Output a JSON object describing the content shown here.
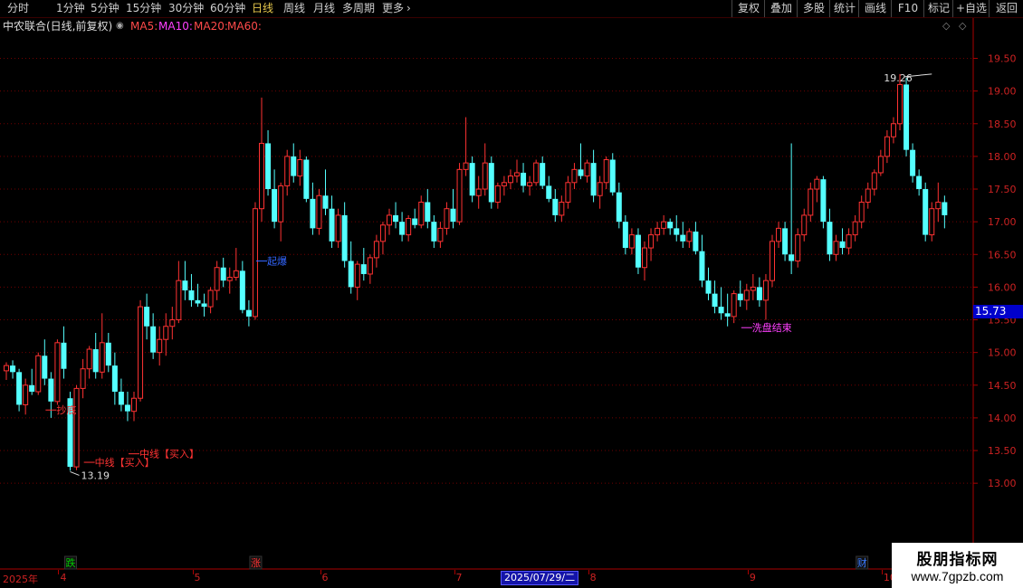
{
  "toolbar": {
    "periods": [
      "分时",
      "1分钟",
      "5分钟",
      "15分钟",
      "30分钟",
      "60分钟",
      "日线",
      "周线",
      "月线",
      "多周期",
      "更多"
    ],
    "active_period": "日线",
    "buttons": [
      "复权",
      "叠加",
      "多股",
      "统计",
      "画线",
      "F10",
      "标记",
      "+自选",
      "返回"
    ]
  },
  "header": {
    "stock": "中农联合(日线,前复权)",
    "ma_labels": [
      {
        "text": "MA5:",
        "color": "#ff4a4a"
      },
      {
        "text": "MA10:",
        "color": "#ff40ff"
      },
      {
        "text": "MA20:",
        "color": "#ff4a4a"
      },
      {
        "text": "MA60:",
        "color": "#ff4a4a"
      }
    ]
  },
  "chart_data": {
    "type": "candlestick",
    "yaxis_ticks": [
      13.0,
      13.5,
      14.0,
      14.5,
      15.0,
      15.5,
      16.0,
      16.5,
      17.0,
      17.5,
      18.0,
      18.5,
      19.0,
      19.5
    ],
    "ylim": [
      12.85,
      19.95
    ],
    "current_price_label": "15.73",
    "current_price": 15.73,
    "colors": {
      "up": "#ff3232",
      "down": "#54ffff",
      "axis": "#aa0000",
      "grid": "#700000"
    },
    "annotations": [
      {
        "text": "19.26",
        "type": "high",
        "index": 145,
        "price": 19.26,
        "color": "#dddddd"
      },
      {
        "text": "13.19",
        "type": "low",
        "index": 10,
        "price": 13.19,
        "color": "#dddddd"
      },
      {
        "text": "抄底",
        "index": 7,
        "price": 14.12,
        "color": "#ff3333"
      },
      {
        "text": "中线【买入】",
        "index": 13,
        "price": 13.32,
        "color": "#ff3333"
      },
      {
        "text": "中线【买入】",
        "index": 20,
        "price": 13.45,
        "color": "#ff3333"
      },
      {
        "text": "起爆",
        "index": 40,
        "price": 16.4,
        "color": "#3366ff"
      },
      {
        "text": "洗盘结束",
        "index": 116,
        "price": 15.38,
        "color": "#ff40ff"
      }
    ],
    "markers": [
      {
        "text": "跌",
        "index": 10,
        "color": "#00cc00"
      },
      {
        "text": "涨",
        "index": 39,
        "color": "#ff3333"
      },
      {
        "text": "财",
        "index": 134,
        "color": "#3a7bff"
      }
    ],
    "candles": [
      [
        14.72,
        14.85,
        14.58,
        14.8
      ],
      [
        14.8,
        14.88,
        14.6,
        14.7
      ],
      [
        14.7,
        14.75,
        14.1,
        14.2
      ],
      [
        14.2,
        14.6,
        14.05,
        14.5
      ],
      [
        14.5,
        14.75,
        14.35,
        14.4
      ],
      [
        14.4,
        15.0,
        14.35,
        14.95
      ],
      [
        14.95,
        15.2,
        14.5,
        14.6
      ],
      [
        14.6,
        14.7,
        14.0,
        14.25
      ],
      [
        14.25,
        15.2,
        14.2,
        15.15
      ],
      [
        15.15,
        15.4,
        14.6,
        14.75
      ],
      [
        14.3,
        14.4,
        13.19,
        13.25
      ],
      [
        13.25,
        14.5,
        13.2,
        14.45
      ],
      [
        14.45,
        14.9,
        14.3,
        14.75
      ],
      [
        14.75,
        15.1,
        14.6,
        15.05
      ],
      [
        15.05,
        15.3,
        14.6,
        14.7
      ],
      [
        14.7,
        15.6,
        14.6,
        15.15
      ],
      [
        15.15,
        15.3,
        14.7,
        14.8
      ],
      [
        14.8,
        15.0,
        14.2,
        14.4
      ],
      [
        14.4,
        14.6,
        14.1,
        14.2
      ],
      [
        14.2,
        14.4,
        13.95,
        14.1
      ],
      [
        14.1,
        14.4,
        13.95,
        14.3
      ],
      [
        14.3,
        15.8,
        14.25,
        15.7
      ],
      [
        15.7,
        15.9,
        15.2,
        15.4
      ],
      [
        15.4,
        15.6,
        14.9,
        15.0
      ],
      [
        15.0,
        15.4,
        14.8,
        15.2
      ],
      [
        15.2,
        15.6,
        14.95,
        15.4
      ],
      [
        15.4,
        15.7,
        15.2,
        15.5
      ],
      [
        15.5,
        16.4,
        15.45,
        16.1
      ],
      [
        16.1,
        16.4,
        15.8,
        15.95
      ],
      [
        15.95,
        16.2,
        15.7,
        15.8
      ],
      [
        15.8,
        16.05,
        15.7,
        15.75
      ],
      [
        15.75,
        15.9,
        15.55,
        15.7
      ],
      [
        15.7,
        16.0,
        15.6,
        15.95
      ],
      [
        15.95,
        16.4,
        15.8,
        16.3
      ],
      [
        16.3,
        16.45,
        16.0,
        16.1
      ],
      [
        16.1,
        16.3,
        15.9,
        16.15
      ],
      [
        16.15,
        16.6,
        16.1,
        16.25
      ],
      [
        16.25,
        16.4,
        15.6,
        15.65
      ],
      [
        15.65,
        15.8,
        15.4,
        15.55
      ],
      [
        15.55,
        17.3,
        15.5,
        17.2
      ],
      [
        17.2,
        18.9,
        17.0,
        18.2
      ],
      [
        18.2,
        18.4,
        17.4,
        17.5
      ],
      [
        17.5,
        17.8,
        16.9,
        17.0
      ],
      [
        17.0,
        17.6,
        16.7,
        17.55
      ],
      [
        17.55,
        18.1,
        17.4,
        18.0
      ],
      [
        18.0,
        18.2,
        17.6,
        17.7
      ],
      [
        17.7,
        18.1,
        17.55,
        17.95
      ],
      [
        17.95,
        18.0,
        17.3,
        17.35
      ],
      [
        17.35,
        17.6,
        16.8,
        16.9
      ],
      [
        16.9,
        17.5,
        16.8,
        17.4
      ],
      [
        17.4,
        17.8,
        17.1,
        17.2
      ],
      [
        17.2,
        17.4,
        16.6,
        16.7
      ],
      [
        16.7,
        17.2,
        16.6,
        17.1
      ],
      [
        17.1,
        17.3,
        16.3,
        16.4
      ],
      [
        16.4,
        16.7,
        15.9,
        16.0
      ],
      [
        16.0,
        16.4,
        15.8,
        16.35
      ],
      [
        16.35,
        16.6,
        16.1,
        16.2
      ],
      [
        16.2,
        16.5,
        16.05,
        16.45
      ],
      [
        16.45,
        16.8,
        16.3,
        16.7
      ],
      [
        16.7,
        17.0,
        16.5,
        16.95
      ],
      [
        16.95,
        17.2,
        16.8,
        17.1
      ],
      [
        17.1,
        17.3,
        16.9,
        17.0
      ],
      [
        17.0,
        17.15,
        16.7,
        16.8
      ],
      [
        16.8,
        17.1,
        16.7,
        17.05
      ],
      [
        17.05,
        17.2,
        16.9,
        16.95
      ],
      [
        16.95,
        17.4,
        16.9,
        17.3
      ],
      [
        17.3,
        17.5,
        16.9,
        17.0
      ],
      [
        17.0,
        17.1,
        16.6,
        16.7
      ],
      [
        16.7,
        17.0,
        16.6,
        16.9
      ],
      [
        16.9,
        17.3,
        16.8,
        17.2
      ],
      [
        17.2,
        17.5,
        16.9,
        17.0
      ],
      [
        17.0,
        17.9,
        16.95,
        17.8
      ],
      [
        17.8,
        18.6,
        17.7,
        17.9
      ],
      [
        17.9,
        18.0,
        17.3,
        17.4
      ],
      [
        17.4,
        17.7,
        17.2,
        17.5
      ],
      [
        17.5,
        18.2,
        17.4,
        17.9
      ],
      [
        17.9,
        18.0,
        17.2,
        17.3
      ],
      [
        17.3,
        17.6,
        17.2,
        17.55
      ],
      [
        17.55,
        17.7,
        17.4,
        17.6
      ],
      [
        17.6,
        17.8,
        17.5,
        17.7
      ],
      [
        17.7,
        17.95,
        17.6,
        17.75
      ],
      [
        17.75,
        17.9,
        17.45,
        17.55
      ],
      [
        17.55,
        17.7,
        17.4,
        17.6
      ],
      [
        17.6,
        17.95,
        17.55,
        17.9
      ],
      [
        17.9,
        18.0,
        17.5,
        17.55
      ],
      [
        17.55,
        17.7,
        17.3,
        17.35
      ],
      [
        17.35,
        17.5,
        17.0,
        17.1
      ],
      [
        17.1,
        17.4,
        17.0,
        17.3
      ],
      [
        17.3,
        17.7,
        17.2,
        17.6
      ],
      [
        17.6,
        17.9,
        17.5,
        17.8
      ],
      [
        17.8,
        18.2,
        17.65,
        17.7
      ],
      [
        17.7,
        17.95,
        17.6,
        17.9
      ],
      [
        17.9,
        18.1,
        17.3,
        17.4
      ],
      [
        17.4,
        17.7,
        17.2,
        17.6
      ],
      [
        17.6,
        18.0,
        17.5,
        17.95
      ],
      [
        17.95,
        18.05,
        17.4,
        17.45
      ],
      [
        17.45,
        17.6,
        16.9,
        17.0
      ],
      [
        17.0,
        17.1,
        16.5,
        16.6
      ],
      [
        16.6,
        16.9,
        16.5,
        16.8
      ],
      [
        16.8,
        16.9,
        16.2,
        16.3
      ],
      [
        16.3,
        16.7,
        16.1,
        16.6
      ],
      [
        16.6,
        16.9,
        16.4,
        16.8
      ],
      [
        16.8,
        17.0,
        16.7,
        16.9
      ],
      [
        16.9,
        17.1,
        16.8,
        17.0
      ],
      [
        17.0,
        17.05,
        16.8,
        16.9
      ],
      [
        16.9,
        17.1,
        16.7,
        16.8
      ],
      [
        16.8,
        17.0,
        16.6,
        16.7
      ],
      [
        16.7,
        16.9,
        16.6,
        16.85
      ],
      [
        16.85,
        17.0,
        16.5,
        16.55
      ],
      [
        16.55,
        16.8,
        16.0,
        16.1
      ],
      [
        16.1,
        16.3,
        15.8,
        15.9
      ],
      [
        15.9,
        16.1,
        15.6,
        15.7
      ],
      [
        15.7,
        16.0,
        15.5,
        15.6
      ],
      [
        15.6,
        15.9,
        15.4,
        15.55
      ],
      [
        15.55,
        15.95,
        15.45,
        15.9
      ],
      [
        15.9,
        16.1,
        15.7,
        15.8
      ],
      [
        15.8,
        16.05,
        15.65,
        15.95
      ],
      [
        15.95,
        16.2,
        15.8,
        16.0
      ],
      [
        16.0,
        16.15,
        15.7,
        15.8
      ],
      [
        15.8,
        16.2,
        15.5,
        16.1
      ],
      [
        16.1,
        16.8,
        16.0,
        16.7
      ],
      [
        16.7,
        17.0,
        16.6,
        16.9
      ],
      [
        16.9,
        17.0,
        16.4,
        16.5
      ],
      [
        16.5,
        18.2,
        16.2,
        16.4
      ],
      [
        16.4,
        16.9,
        16.3,
        16.8
      ],
      [
        16.8,
        17.2,
        16.7,
        17.1
      ],
      [
        17.1,
        17.6,
        17.0,
        17.5
      ],
      [
        17.5,
        17.7,
        17.3,
        17.65
      ],
      [
        17.65,
        17.7,
        16.9,
        17.0
      ],
      [
        17.0,
        17.2,
        16.4,
        16.5
      ],
      [
        16.5,
        16.8,
        16.4,
        16.7
      ],
      [
        16.7,
        16.9,
        16.5,
        16.6
      ],
      [
        16.6,
        16.9,
        16.5,
        16.8
      ],
      [
        16.8,
        17.1,
        16.7,
        17.0
      ],
      [
        17.0,
        17.4,
        16.9,
        17.3
      ],
      [
        17.3,
        17.6,
        17.2,
        17.5
      ],
      [
        17.5,
        17.8,
        17.4,
        17.75
      ],
      [
        17.75,
        18.1,
        17.7,
        18.0
      ],
      [
        18.0,
        18.4,
        17.9,
        18.3
      ],
      [
        18.3,
        18.6,
        18.2,
        18.5
      ],
      [
        18.5,
        19.26,
        18.4,
        19.1
      ],
      [
        19.1,
        19.2,
        18.0,
        18.1
      ],
      [
        18.1,
        18.2,
        17.6,
        17.7
      ],
      [
        17.7,
        17.8,
        17.4,
        17.5
      ],
      [
        17.5,
        17.6,
        16.7,
        16.8
      ],
      [
        16.8,
        17.3,
        16.7,
        17.2
      ],
      [
        17.2,
        17.6,
        17.0,
        17.3
      ],
      [
        17.3,
        17.4,
        16.9,
        17.1
      ]
    ],
    "time_axis": [
      {
        "text": "2025年",
        "index": 0
      },
      {
        "text": "4",
        "index": 9
      },
      {
        "text": "5",
        "index": 30
      },
      {
        "text": "6",
        "index": 50
      },
      {
        "text": "7",
        "index": 71
      },
      {
        "text": "8",
        "index": 92
      },
      {
        "text": "9",
        "index": 117
      },
      {
        "text": "10",
        "index": 138
      },
      {
        "text": "11",
        "index": 157
      }
    ],
    "selected_date": "2025/07/29/二"
  },
  "watermark": {
    "line1": "股朋指标网",
    "line2": "www.7gpzb.com"
  }
}
